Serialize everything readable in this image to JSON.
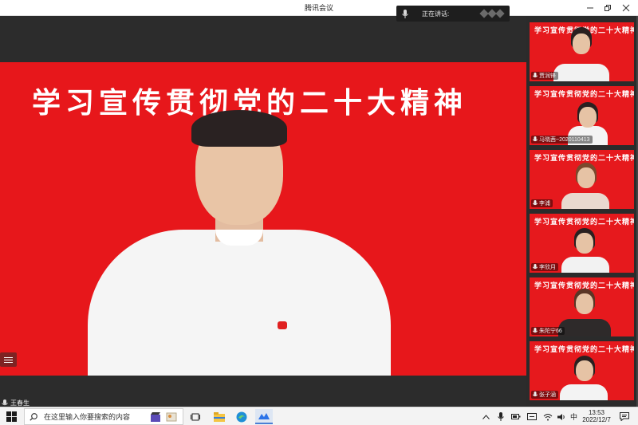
{
  "window": {
    "title": "腾讯会议"
  },
  "speaking_indicator": {
    "label": "正在讲话:"
  },
  "main_video": {
    "banner_text": "学习宣传贯彻党的二十大精神",
    "speaker_name": "王春生"
  },
  "participants": [
    {
      "name": "贾润锋"
    },
    {
      "name": "马晓茜~2020110413"
    },
    {
      "name": "李浦"
    },
    {
      "name": "李欣月"
    },
    {
      "name": "朱陀宁66"
    },
    {
      "name": "张子涵"
    }
  ],
  "tile_banner_text": "学习宣传贯彻党的二十大精神",
  "taskbar": {
    "search_placeholder": "在这里输入你要搜索的内容",
    "ime_label": "中",
    "time": "13:53",
    "date": "2022/12/7"
  },
  "colors": {
    "stage_red": "#e7171b",
    "background_dark": "#2b2b2b"
  },
  "icons": [
    "windows-start-icon",
    "search-icon",
    "task-view-icon",
    "file-explorer-icon",
    "edge-icon",
    "tencent-meeting-icon",
    "microphone-icon",
    "list-icon"
  ]
}
